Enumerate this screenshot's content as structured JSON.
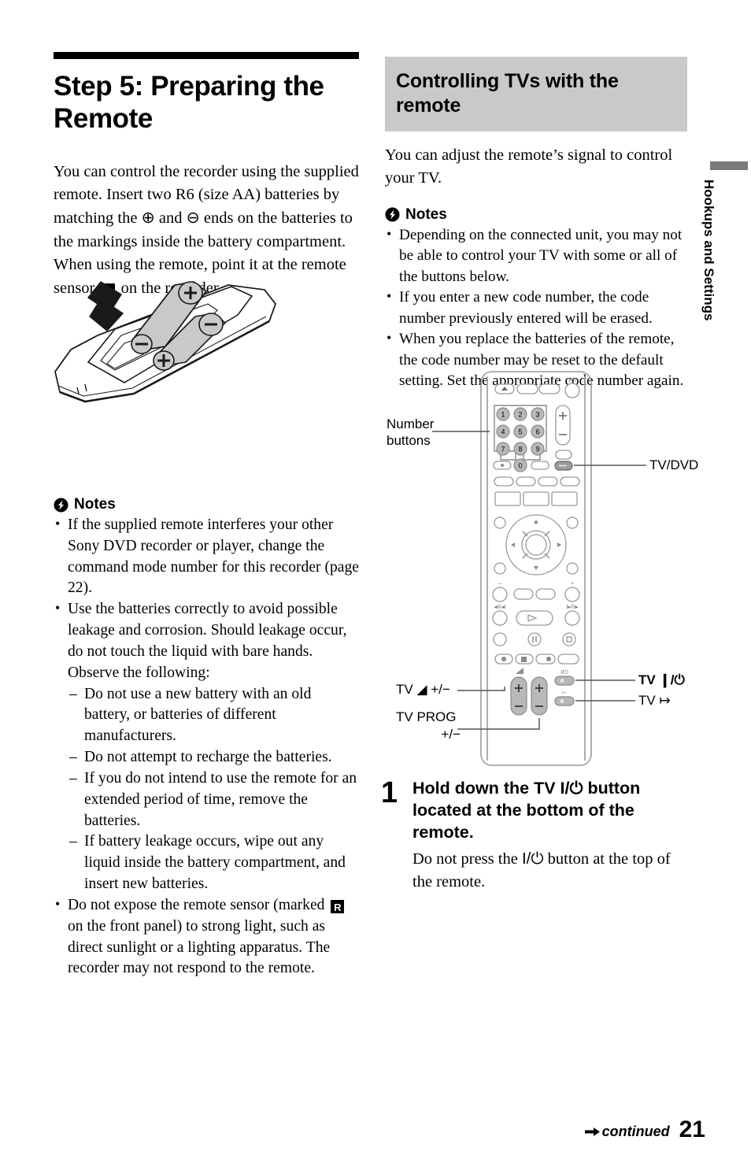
{
  "page": {
    "number": "21",
    "continued_label": "continued",
    "side_tab": "Hookups and Settings"
  },
  "left_column": {
    "heading": "Step 5: Preparing the Remote",
    "intro": "You can control the recorder using the supplied remote. Insert two R6 (size AA) batteries by matching the ⊕ and ⊖ ends on the batteries to the markings inside the battery compartment. When using the remote, point it at the remote sensor ",
    "intro_tail": " on the recorder.",
    "sensor_icon_letter": "R",
    "figure_caption": "remote-battery-compartment-illustration",
    "notes_label": "Notes",
    "notes": [
      "If the supplied remote interferes your other Sony DVD recorder or player, change the command mode number for this recorder (page 22).",
      "Use the batteries correctly to avoid possible leakage and corrosion. Should leakage occur, do not touch the liquid with bare hands. Observe the following:"
    ],
    "subnotes": [
      "Do not use a new battery with an old battery, or batteries of different manufacturers.",
      "Do not attempt to recharge the batteries.",
      "If you do not intend to use the remote for an extended period of time, remove the batteries.",
      "If battery leakage occurs, wipe out any liquid inside the battery compartment, and insert new batteries."
    ],
    "note_last_head": "Do not expose the remote sensor (marked ",
    "note_last_tail": " on the front panel) to strong light, such as direct sunlight or a lighting apparatus. The recorder may not respond to the remote."
  },
  "right_column": {
    "heading": "Controlling TVs with the remote",
    "intro": "You can adjust the remote’s signal to control your TV.",
    "notes_label": "Notes",
    "notes": [
      "Depending on the connected unit, you may not be able to control your TV with some or all of the buttons below.",
      "If you enter a new code number, the code number previously entered will be erased.",
      "When you replace the batteries of the remote, the code number may be reset to the default setting. Set the appropriate code number again."
    ]
  },
  "remote_diagram": {
    "callouts": {
      "number_buttons": "Number\nbuttons",
      "number_buttons_line1": "Number",
      "number_buttons_line2": "buttons",
      "tv_dvd": "TV/DVD",
      "tv_volume": "TV ◢ +/−",
      "tv_prog_line1": "TV PROG",
      "tv_prog_line2": "+/−",
      "tv_power": "TV ❙/⏻",
      "tv_input": "TV ↦"
    },
    "keypad": [
      "1",
      "2",
      "3",
      "4",
      "5",
      "6",
      "7",
      "8",
      "9",
      "0"
    ],
    "volume_plus": "+",
    "volume_minus": "−",
    "power_symbol": "I/⏻"
  },
  "step": {
    "number": "1",
    "title_pre": "Hold down the TV ",
    "title_sym": "I/⏻",
    "title_post": " button located at the bottom of the remote.",
    "sub_pre": "Do not press the ",
    "sub_sym": "I/⏻",
    "sub_post": " button at the top of the remote."
  },
  "colors": {
    "heading_band": "#c9c9c9",
    "rule": "#000000",
    "side_tab_bar": "#7a7a7a",
    "remote_body": "#ffffff",
    "remote_outline": "#9a9a9a",
    "button_fill": "#b8b8b8"
  }
}
